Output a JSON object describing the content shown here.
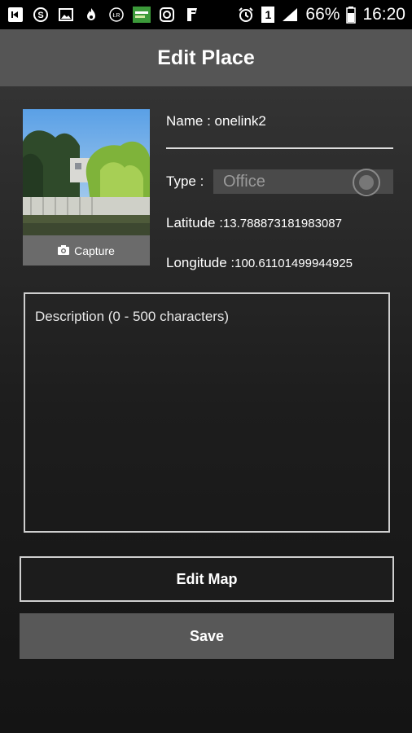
{
  "status_bar": {
    "icons": [
      "back-arrow-icon",
      "skype-icon",
      "gallery-icon",
      "fire-icon",
      "ltr-icon",
      "app-icon",
      "instagram-icon",
      "foursquare-icon"
    ],
    "alarm_icon": "alarm-icon",
    "sim_badge": "1",
    "battery_percent": "66%",
    "time": "16:20"
  },
  "appbar": {
    "title": "Edit Place"
  },
  "photo": {
    "capture_label": "Capture"
  },
  "form": {
    "name_label": "Name :",
    "name_value": "onelink2",
    "type_label": "Type :",
    "type_value": "Office",
    "latitude_label": "Latitude :",
    "latitude_value": "13.788873181983087",
    "longitude_label": "Longitude :",
    "longitude_value": "100.61101499944925",
    "description_placeholder": "Description (0 - 500 characters)"
  },
  "buttons": {
    "edit_map": "Edit Map",
    "save": "Save"
  }
}
